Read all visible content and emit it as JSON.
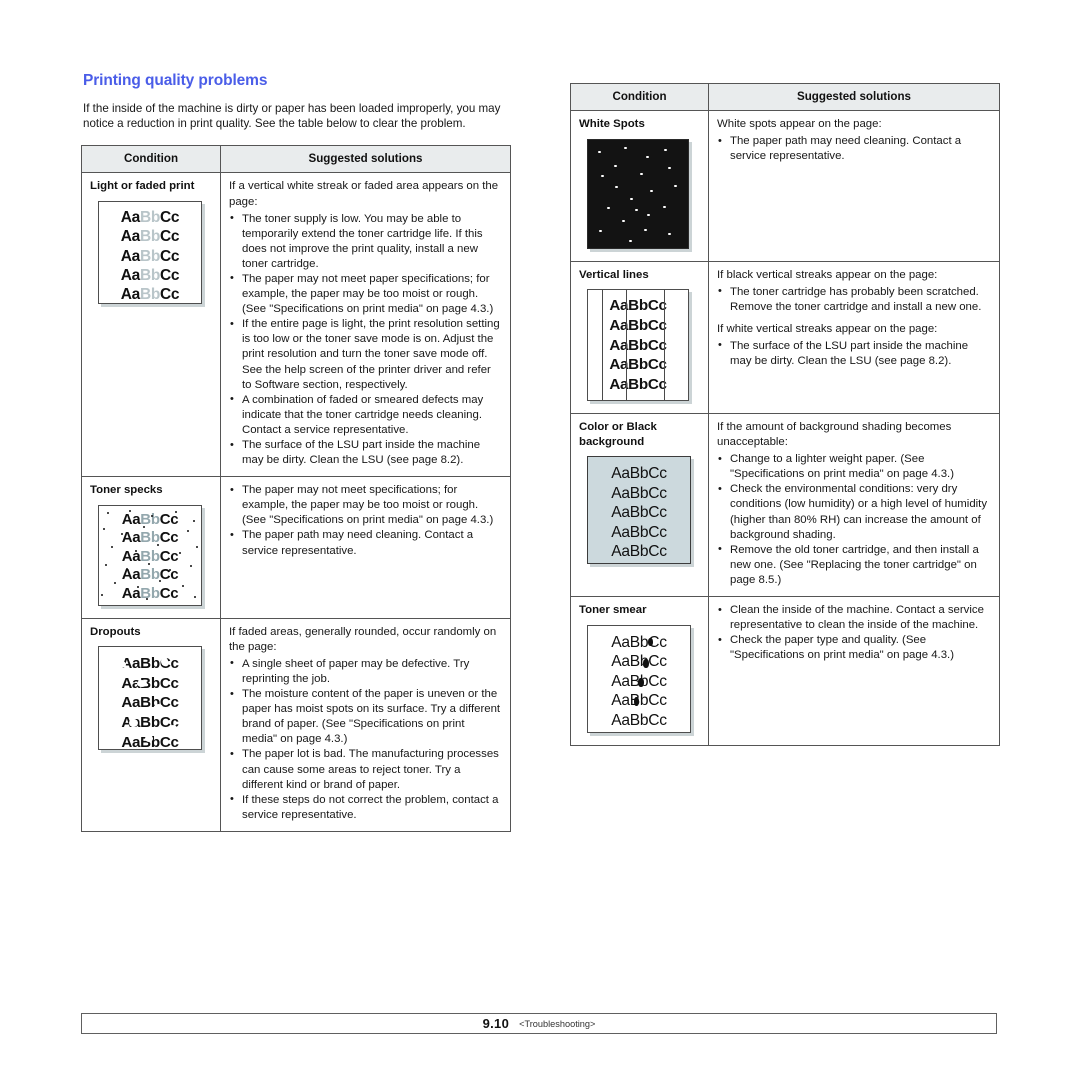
{
  "section": {
    "title": "Printing quality problems",
    "title_color": "#4a5de8",
    "intro": "If the inside of the machine is dirty or paper has been loaded improperly, you may notice a reduction in print quality. See the table below to clear the problem."
  },
  "table_headers": {
    "condition": "Condition",
    "solutions": "Suggested solutions"
  },
  "left_table": {
    "rows": [
      {
        "condition": "Light or faded print",
        "sample": "faded-print-sample",
        "lead": "If a vertical white streak or faded area appears on the page:",
        "bullets": [
          "The toner supply is low. You may be able to temporarily extend the toner cartridge life. If this does not improve the print quality, install a new toner cartridge.",
          "The paper may not meet paper specifications; for example, the paper may be too moist or rough. (See \"Specifications on print media\" on page 4.3.)",
          "If the entire page is light, the print resolution setting is too low or the toner save mode is on. Adjust the print resolution and turn the toner save mode off. See the help screen of the printer driver and refer to Software section, respectively.",
          "A combination of faded or smeared defects may indicate that the toner cartridge needs cleaning. Contact a service representative.",
          "The surface of the LSU part inside the machine may be dirty. Clean the LSU (see page  8.2)."
        ]
      },
      {
        "condition": "Toner specks",
        "sample": "toner-specks-sample",
        "lead": "",
        "bullets": [
          "The paper may not meet specifications; for example, the paper may be too moist or rough. (See \"Specifications on print media\" on page 4.3.)",
          "The paper path may need cleaning. Contact a service representative."
        ]
      },
      {
        "condition": "Dropouts",
        "sample": "dropouts-sample",
        "lead": "If faded areas, generally rounded, occur randomly on the page:",
        "bullets": [
          "A single sheet of paper may be defective. Try reprinting the job.",
          "The moisture content of the paper is uneven or the paper has moist spots on its surface. Try a different brand of paper. (See \"Specifications on print media\" on page 4.3.)",
          "The paper lot is bad. The manufacturing processes can cause some areas to reject toner. Try a different kind or brand of paper.",
          "If these steps do not correct the problem, contact a service representative."
        ]
      }
    ]
  },
  "right_table": {
    "rows": [
      {
        "condition": "White Spots",
        "sample": "white-spots-sample",
        "lead": "White spots appear on the page:",
        "bullets": [
          "The paper path may need cleaning. Contact a service representative."
        ]
      },
      {
        "condition": "Vertical lines",
        "sample": "vertical-lines-sample",
        "lead": "If black vertical streaks appear on the page:",
        "bullets": [
          "The toner cartridge has probably been scratched. Remove the toner cartridge and install a new one."
        ],
        "lead2": "If white vertical streaks appear on the page:",
        "bullets2": [
          "The surface of the LSU part inside the machine may be dirty. Clean the LSU (see page  8.2)."
        ]
      },
      {
        "condition": "Color or Black background",
        "sample": "black-background-sample",
        "lead": "If the amount of background shading becomes unacceptable:",
        "bullets": [
          "Change to a lighter weight paper. (See \"Specifications on print media\" on page 4.3.)",
          "Check the environmental conditions: very dry conditions (low humidity) or a high level of humidity (higher than 80% RH) can increase the amount of background shading.",
          "Remove the old toner cartridge, and then install a new one. (See \"Replacing the toner cartridge\" on page 8.5.)"
        ]
      },
      {
        "condition": "Toner smear",
        "sample": "toner-smear-sample",
        "lead": "",
        "bullets": [
          "Clean the inside of the machine. Contact a service representative to clean the inside of the machine.",
          "Check the paper type and quality. (See \"Specifications on print media\" on page 4.3.)"
        ]
      }
    ]
  },
  "samples": {
    "text_line": "AaBbCc",
    "faded_prefix": "Aa",
    "faded_mid": "Bb",
    "faded_suffix": "Cc"
  },
  "footer": {
    "page_number": "9.10",
    "chapter": "<Troubleshooting>"
  }
}
